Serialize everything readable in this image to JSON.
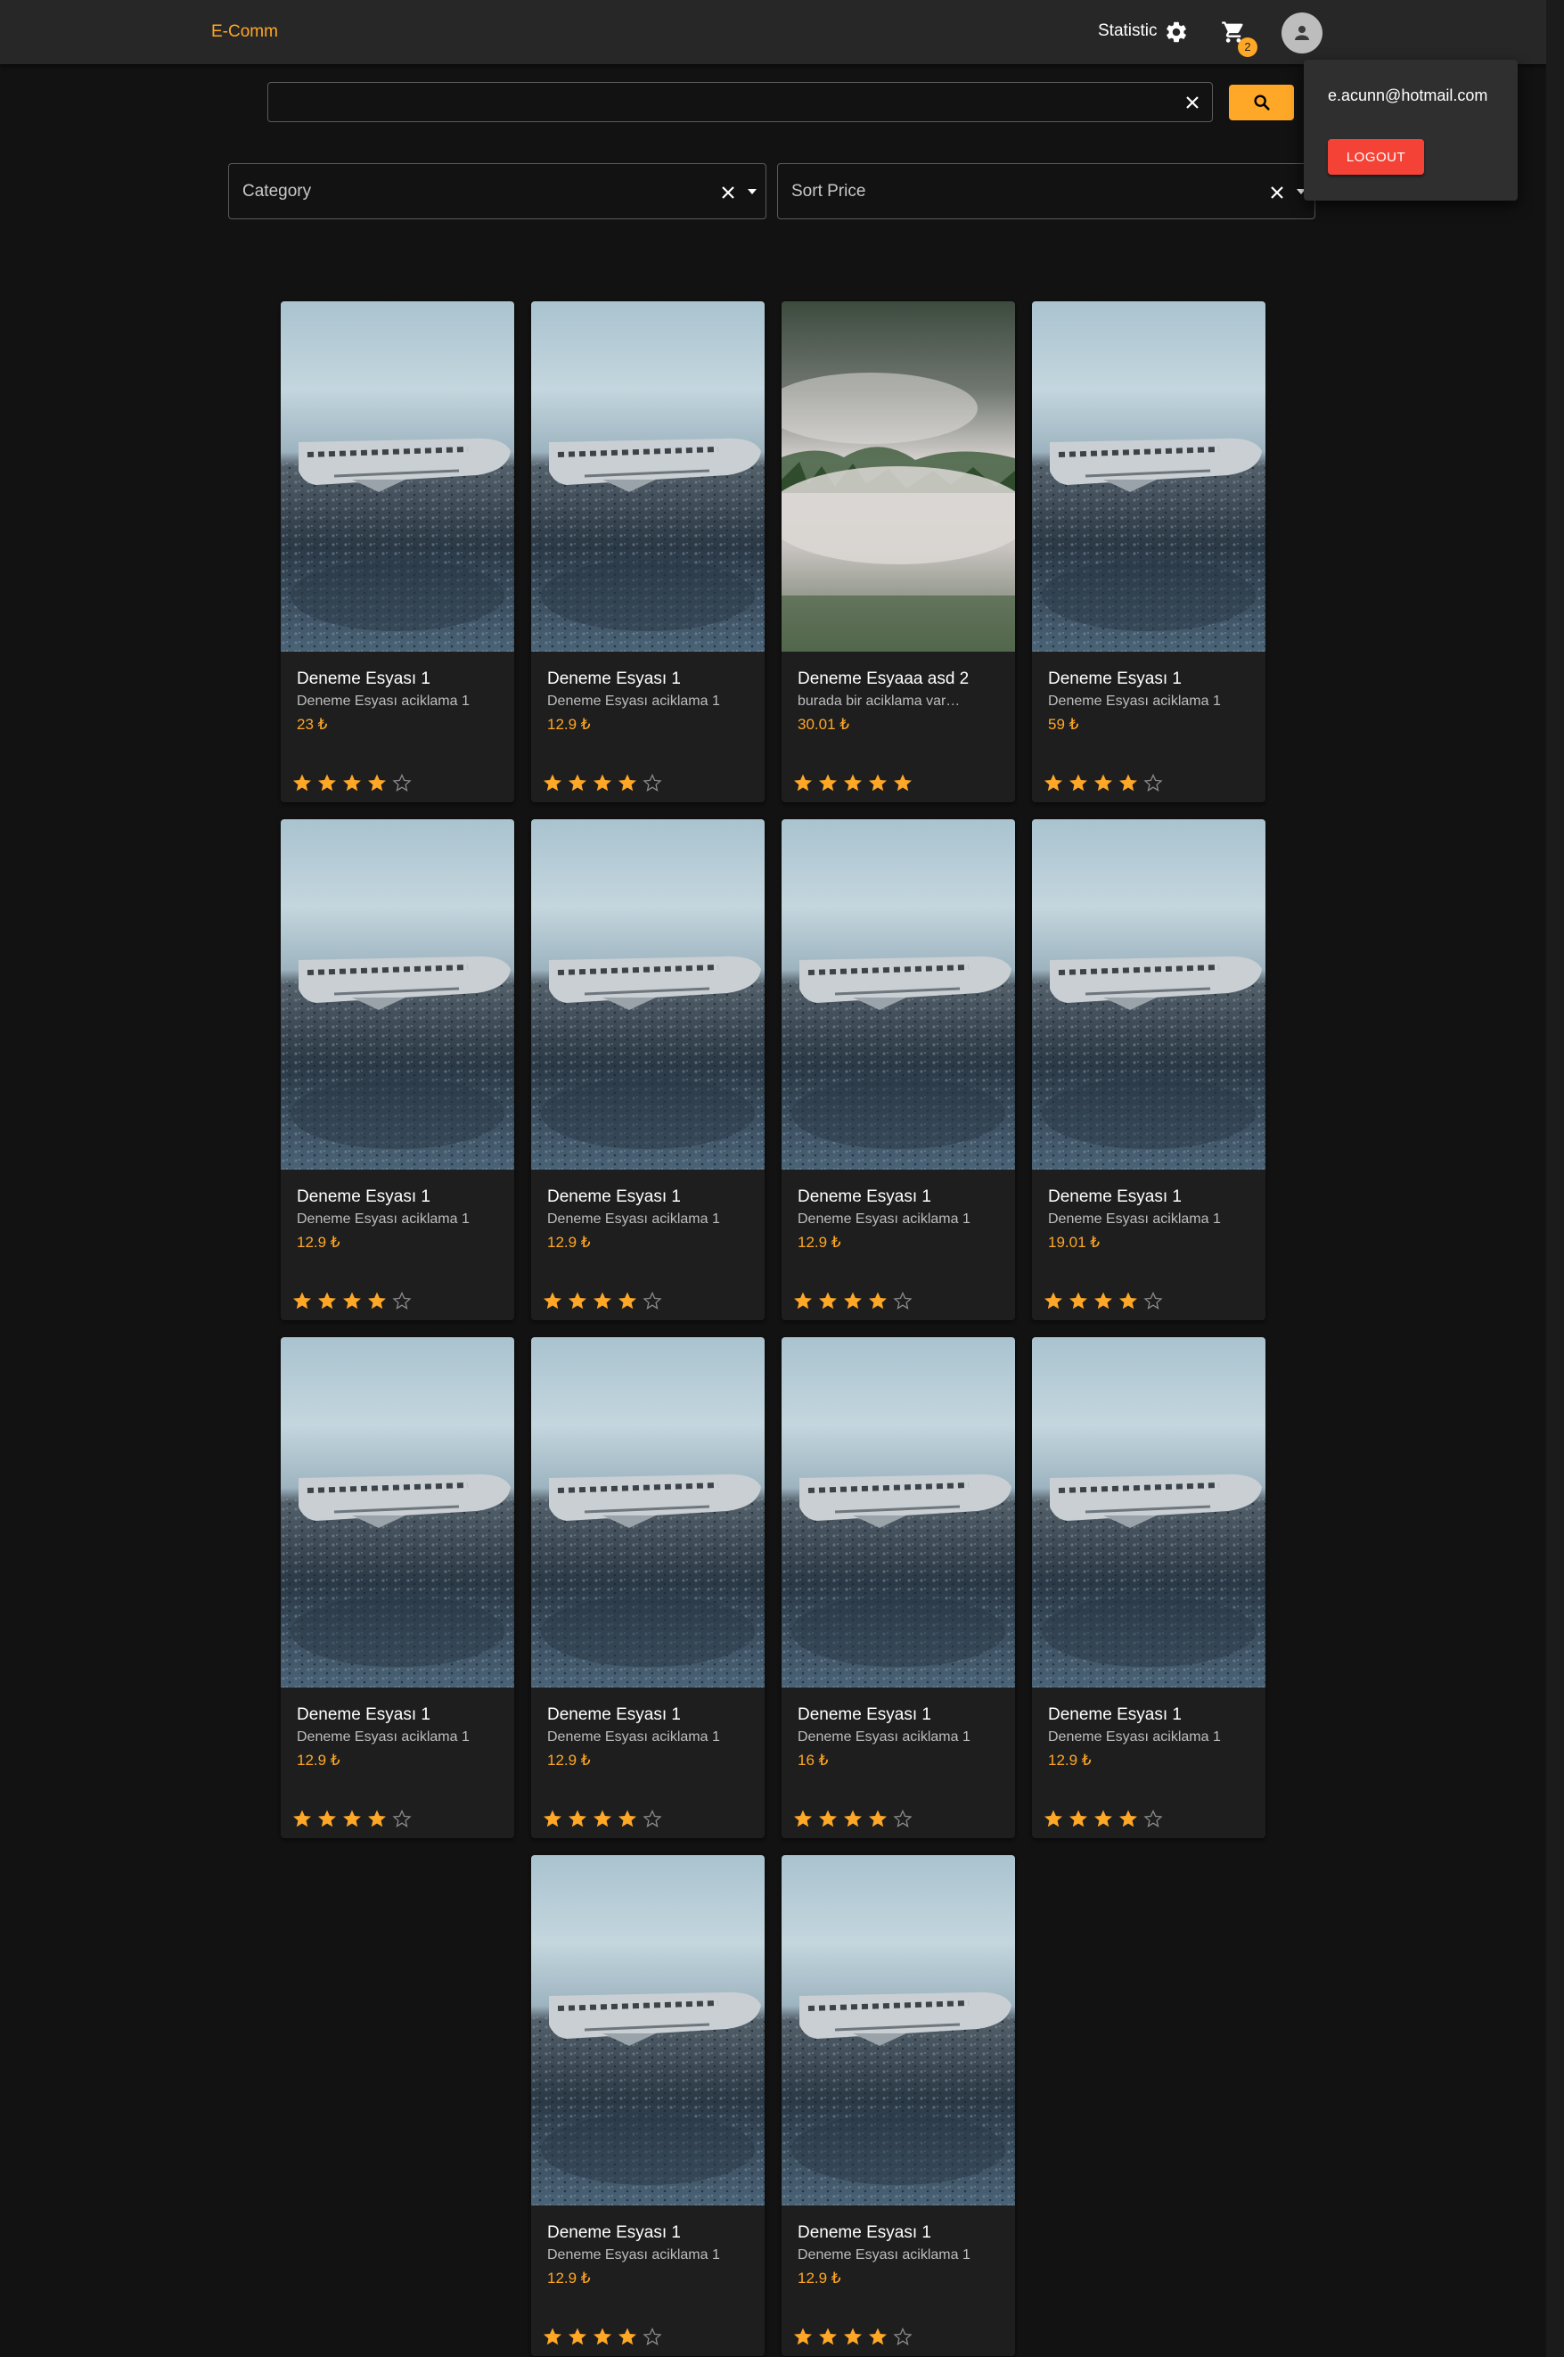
{
  "header": {
    "brand": "E-Comm",
    "statistic_label": "Statistic",
    "cart_count": "2",
    "icons": {
      "settings": "gear-icon",
      "cart": "cart-icon",
      "account": "account-icon"
    }
  },
  "user_menu": {
    "email": "e.acunn@hotmail.com",
    "logout_label": "LOGOUT"
  },
  "search": {
    "value": "",
    "placeholder": "",
    "clear_icon": "close-icon",
    "button_icon": "search-icon"
  },
  "filters": {
    "category": {
      "label": "Category",
      "value": ""
    },
    "sort_price": {
      "label": "Sort Price",
      "value": ""
    }
  },
  "colors": {
    "accent": "#ffa726",
    "danger": "#f44336",
    "background": "#121212",
    "appbar": "#272727",
    "card": "#1e1e1e",
    "star_empty": "#8a8a8a"
  },
  "products": [
    {
      "title": "Deneme Esyası 1",
      "description": "Deneme Esyası aciklama 1",
      "price": "23 ₺",
      "rating": 4,
      "image": "plane-wreck"
    },
    {
      "title": "Deneme Esyası 1",
      "description": "Deneme Esyası aciklama 1",
      "price": "12.9 ₺",
      "rating": 4,
      "image": "plane-wreck"
    },
    {
      "title": "Deneme Esyaaa asd 2",
      "description": "burada bir aciklama var…",
      "price": "30.01 ₺",
      "rating": 5,
      "image": "foggy-forest"
    },
    {
      "title": "Deneme Esyası 1",
      "description": "Deneme Esyası aciklama 1",
      "price": "59 ₺",
      "rating": 4,
      "image": "plane-wreck"
    },
    {
      "title": "Deneme Esyası 1",
      "description": "Deneme Esyası aciklama 1",
      "price": "12.9 ₺",
      "rating": 4,
      "image": "plane-wreck"
    },
    {
      "title": "Deneme Esyası 1",
      "description": "Deneme Esyası aciklama 1",
      "price": "12.9 ₺",
      "rating": 4,
      "image": "plane-wreck"
    },
    {
      "title": "Deneme Esyası 1",
      "description": "Deneme Esyası aciklama 1",
      "price": "12.9 ₺",
      "rating": 4,
      "image": "plane-wreck"
    },
    {
      "title": "Deneme Esyası 1",
      "description": "Deneme Esyası aciklama 1",
      "price": "19.01 ₺",
      "rating": 4,
      "image": "plane-wreck"
    },
    {
      "title": "Deneme Esyası 1",
      "description": "Deneme Esyası aciklama 1",
      "price": "12.9 ₺",
      "rating": 4,
      "image": "plane-wreck"
    },
    {
      "title": "Deneme Esyası 1",
      "description": "Deneme Esyası aciklama 1",
      "price": "12.9 ₺",
      "rating": 4,
      "image": "plane-wreck"
    },
    {
      "title": "Deneme Esyası 1",
      "description": "Deneme Esyası aciklama 1",
      "price": "16 ₺",
      "rating": 4,
      "image": "plane-wreck"
    },
    {
      "title": "Deneme Esyası 1",
      "description": "Deneme Esyası aciklama 1",
      "price": "12.9 ₺",
      "rating": 4,
      "image": "plane-wreck"
    },
    {
      "title": "Deneme Esyası 1",
      "description": "Deneme Esyası aciklama 1",
      "price": "12.9 ₺",
      "rating": 4,
      "image": "plane-wreck"
    },
    {
      "title": "Deneme Esyası 1",
      "description": "Deneme Esyası aciklama 1",
      "price": "12.9 ₺",
      "rating": 4,
      "image": "plane-wreck"
    }
  ]
}
